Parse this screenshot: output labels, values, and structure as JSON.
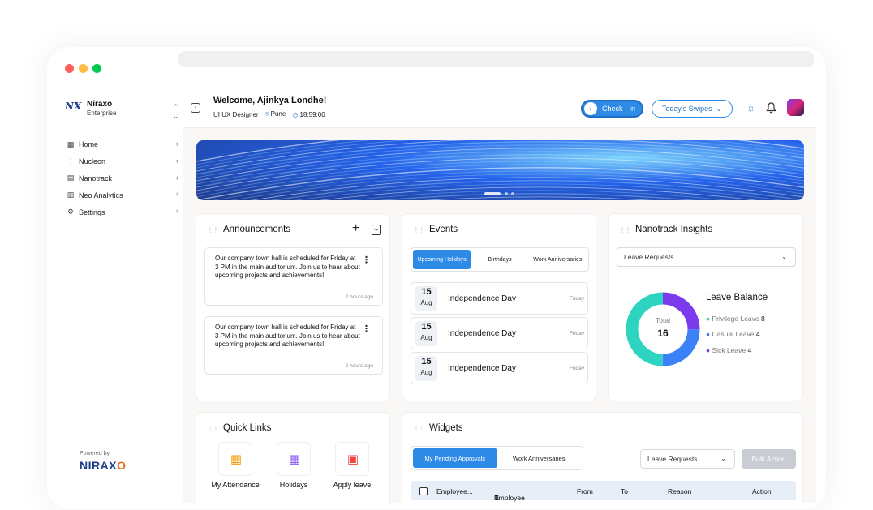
{
  "sidebar": {
    "brand_name": "Niraxo",
    "brand_sub": "Enterprise",
    "brand_logo": "NX",
    "items": [
      {
        "label": "Home",
        "icon": "grid-icon"
      },
      {
        "label": "Nucleon",
        "icon": "sliders-icon"
      },
      {
        "label": "Nanotrack",
        "icon": "calendar-icon"
      },
      {
        "label": "Neo Analytics",
        "icon": "chart-icon"
      },
      {
        "label": "Settings",
        "icon": "gear-icon"
      }
    ],
    "powered_by": "Powered by",
    "powered_logo_a": "NIRAX",
    "powered_logo_b": "O"
  },
  "topbar": {
    "welcome": "Welcome, Ajinkya Londhe!",
    "role": "UI UX Designer",
    "location": "Pune",
    "time": "18:59:00",
    "checkin_label": "Check - In",
    "swipes_label": "Today's Swipes"
  },
  "announcements": {
    "title": "Announcements",
    "items": [
      {
        "text": "Our company town hall is scheduled for Friday at 3 PM in the main auditorium. Join us to hear about upcoming projects and achievements!",
        "time": "2 hours ago"
      },
      {
        "text": "Our company town hall is scheduled for Friday at 3 PM in the main auditorium. Join us to hear about upcoming projects and achievements!",
        "time": "2 hours ago"
      }
    ]
  },
  "events": {
    "title": "Events",
    "tabs": [
      {
        "label": "Upcoming Holidays",
        "active": true
      },
      {
        "label": "Birthdays",
        "active": false
      },
      {
        "label": "Work Anniversaries",
        "active": false
      }
    ],
    "items": [
      {
        "day": "15",
        "month": "Aug",
        "name": "Independence Day",
        "weekday": "Friday"
      },
      {
        "day": "15",
        "month": "Aug",
        "name": "Independence Day",
        "weekday": "Friday"
      },
      {
        "day": "15",
        "month": "Aug",
        "name": "Independence Day",
        "weekday": "Friday"
      }
    ]
  },
  "insights": {
    "title": "Nanotrack Insights",
    "select_value": "Leave Requests",
    "total_label": "Total",
    "total_value": "16",
    "balance_title": "Leave Balance",
    "legend": [
      {
        "label": "Privilege Leave",
        "value": "8",
        "color": "#2dd4bf"
      },
      {
        "label": "Casual Leave",
        "value": "4",
        "color": "#3b82f6"
      },
      {
        "label": "Sick Leave",
        "value": "4",
        "color": "#7c3aed"
      }
    ]
  },
  "quick_links": {
    "title": "Quick Links",
    "items": [
      {
        "label": "My Attendance",
        "icon": "attendance-icon",
        "glyph": "📅",
        "color": "#f59e0b"
      },
      {
        "label": "Holidays",
        "icon": "holidays-icon",
        "glyph": "📆",
        "color": "#8b5cf6"
      },
      {
        "label": "Apply leave",
        "icon": "briefcase-icon",
        "glyph": "💼",
        "color": "#ef4444"
      }
    ]
  },
  "widgets": {
    "title": "Widgets",
    "tabs": [
      {
        "label": "My Pending Approvals",
        "active": true
      },
      {
        "label": "Work Anniversaries",
        "active": false
      }
    ],
    "select_value": "Leave Requests",
    "bulk_label": "Bulk Action",
    "columns": [
      "Employee...",
      "Employee Name",
      "From",
      "To",
      "Reason",
      "Action"
    ]
  }
}
